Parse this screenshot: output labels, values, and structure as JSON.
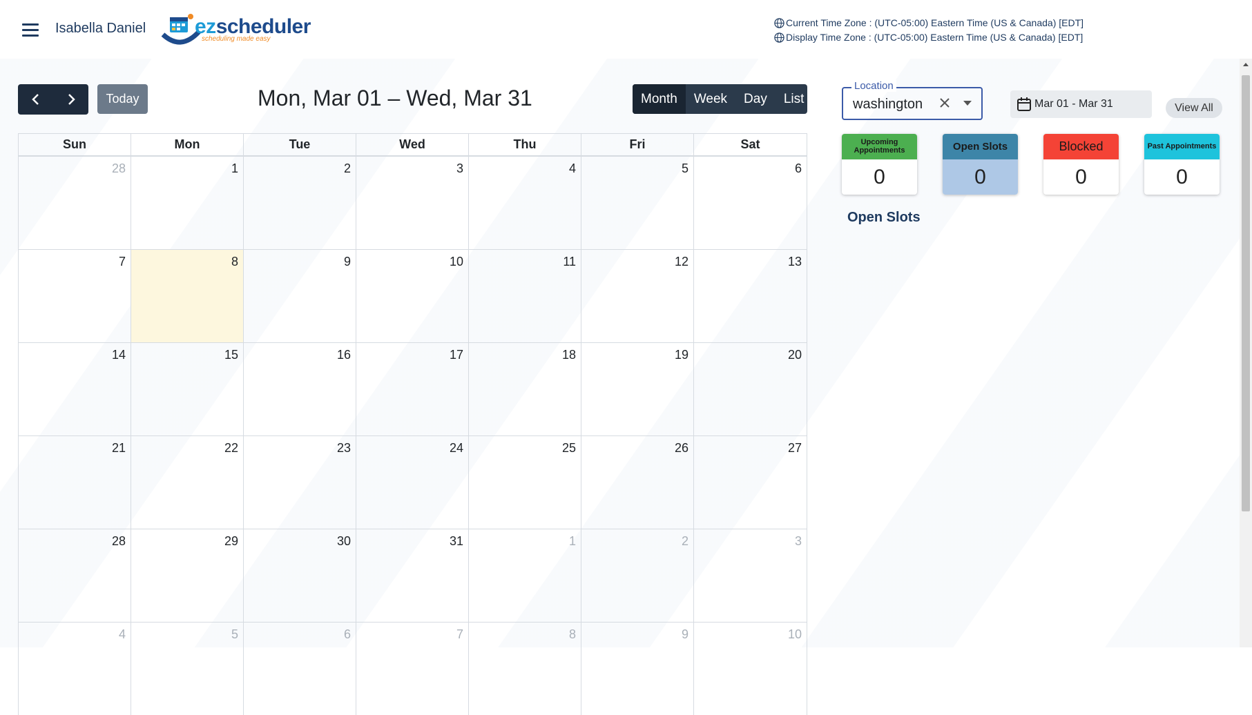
{
  "header": {
    "user_name": "Isabella Daniel",
    "logo_ez": "ez",
    "logo_rest": "scheduler",
    "logo_tagline": "scheduling made easy",
    "current_tz": "Current Time Zone : (UTC-05:00) Eastern Time (US & Canada) [EDT]",
    "display_tz": "Display Time Zone : (UTC-05:00) Eastern Time (US & Canada) [EDT]",
    "icons": [
      "menu-icon",
      "globe-icon"
    ]
  },
  "toolbar": {
    "today": "Today",
    "title": "Mon, Mar 01 – Wed, Mar 31",
    "views": [
      "Month",
      "Week",
      "Day",
      "List"
    ],
    "active_view": "Month"
  },
  "calendar": {
    "weekdays": [
      "Sun",
      "Mon",
      "Tue",
      "Wed",
      "Thu",
      "Fri",
      "Sat"
    ],
    "weeks": [
      [
        {
          "d": "28",
          "o": true
        },
        {
          "d": "1"
        },
        {
          "d": "2"
        },
        {
          "d": "3"
        },
        {
          "d": "4"
        },
        {
          "d": "5"
        },
        {
          "d": "6"
        }
      ],
      [
        {
          "d": "7"
        },
        {
          "d": "8",
          "today": true
        },
        {
          "d": "9"
        },
        {
          "d": "10"
        },
        {
          "d": "11"
        },
        {
          "d": "12"
        },
        {
          "d": "13"
        }
      ],
      [
        {
          "d": "14"
        },
        {
          "d": "15"
        },
        {
          "d": "16"
        },
        {
          "d": "17"
        },
        {
          "d": "18"
        },
        {
          "d": "19"
        },
        {
          "d": "20"
        }
      ],
      [
        {
          "d": "21"
        },
        {
          "d": "22"
        },
        {
          "d": "23"
        },
        {
          "d": "24"
        },
        {
          "d": "25"
        },
        {
          "d": "26"
        },
        {
          "d": "27"
        }
      ],
      [
        {
          "d": "28"
        },
        {
          "d": "29"
        },
        {
          "d": "30"
        },
        {
          "d": "31"
        },
        {
          "d": "1",
          "o": true
        },
        {
          "d": "2",
          "o": true
        },
        {
          "d": "3",
          "o": true
        }
      ],
      [
        {
          "d": "4",
          "o": true
        },
        {
          "d": "5",
          "o": true
        },
        {
          "d": "6",
          "o": true
        },
        {
          "d": "7",
          "o": true
        },
        {
          "d": "8",
          "o": true
        },
        {
          "d": "9",
          "o": true
        },
        {
          "d": "10",
          "o": true
        }
      ]
    ],
    "colors": {
      "today_bg": "#fdf7de"
    }
  },
  "filters": {
    "location_label": "Location",
    "location_value": "washington",
    "date_range": "Mar 01 - Mar 31",
    "view_all": "View All"
  },
  "stats": {
    "upcoming": {
      "label": "Upcoming Appointments",
      "value": "0",
      "color": "#4caf50"
    },
    "open": {
      "label": "Open Slots",
      "value": "0",
      "color": "#3d85a8"
    },
    "blocked": {
      "label": "Blocked",
      "value": "0",
      "color": "#f44336"
    },
    "past": {
      "label": "Past Appointments",
      "value": "0",
      "color": "#1ec3dc"
    }
  },
  "open_slots_title": "Open Slots"
}
